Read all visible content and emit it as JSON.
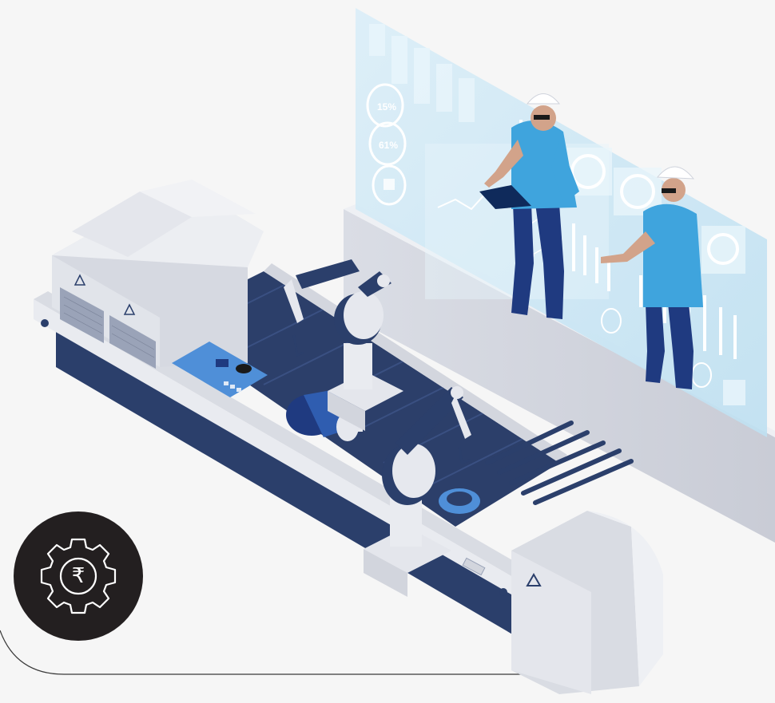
{
  "hologram": {
    "gauges": [
      "15%",
      "61%"
    ]
  },
  "badge": {
    "icon": "gear-rupee-icon",
    "symbol": "₹"
  },
  "colors": {
    "background": "#f6f6f6",
    "navy": "#2b3f6b",
    "light_panel": "#e4e6ec",
    "holo": "#cfe6f3",
    "accent_blue": "#3fa4dd",
    "badge_bg": "#231f20"
  }
}
